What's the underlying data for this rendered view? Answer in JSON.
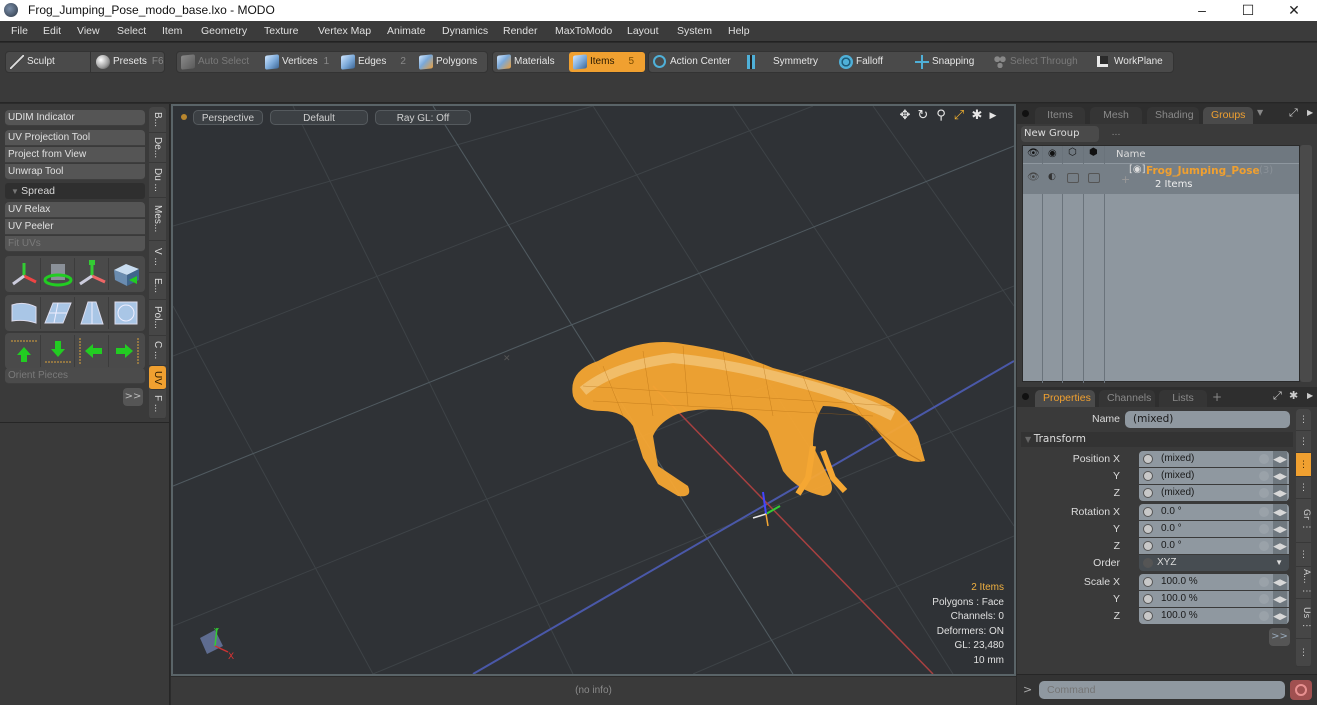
{
  "window": {
    "title": "Frog_Jumping_Pose_modo_base.lxo - MODO",
    "minimize": "–",
    "maximize": "☐",
    "close": "✕"
  },
  "menu": [
    "File",
    "Edit",
    "View",
    "Select",
    "Item",
    "Geometry",
    "Texture",
    "Vertex Map",
    "Animate",
    "Dynamics",
    "Render",
    "MaxToModo",
    "Layout",
    "System",
    "Help"
  ],
  "toolbar": {
    "sculpt": "Sculpt",
    "presets": "Presets",
    "presets_key": "F6",
    "auto_select": "Auto Select",
    "vertices": "Vertices",
    "vertices_key": "1",
    "edges": "Edges",
    "edges_key": "2",
    "polygons": "Polygons",
    "materials": "Materials",
    "items": "Items",
    "items_key": "5",
    "action_center": "Action Center",
    "symmetry": "Symmetry",
    "falloff": "Falloff",
    "snapping": "Snapping",
    "select_through": "Select Through",
    "workplane": "WorkPlane"
  },
  "left_panel": {
    "udim": "UDIM Indicator",
    "uv_projection": "UV Projection Tool",
    "project_from_view": "Project from View",
    "unwrap": "Unwrap Tool",
    "spread": "Spread",
    "uv_relax": "UV Relax",
    "uv_peeler": "UV Peeler",
    "fit_uvs": "Fit UVs",
    "orient_pieces": "Orient Pieces",
    "more": ">>",
    "vtabs": [
      "B...",
      "De...",
      "Du ...",
      "Mes...",
      "V ...",
      "E...",
      "Pol...",
      "C ...",
      "UV",
      "F ..."
    ],
    "active_vtab": "UV"
  },
  "viewport": {
    "view": "Perspective",
    "shading": "Default",
    "raygl": "Ray GL: Off",
    "info": {
      "items": "2 Items",
      "polygons": "Polygons : Face",
      "channels": "Channels: 0",
      "deformers": "Deformers: ON",
      "gl": "GL: 23,480",
      "grid": "10 mm"
    },
    "status": "(no info)",
    "axis_x": "X",
    "axis_y": "Y"
  },
  "groups_panel": {
    "tabs": [
      "Items",
      "Mesh ...",
      "Shading",
      "Groups"
    ],
    "active_tab": "Groups",
    "new_group": "New Group",
    "column_name": "Name",
    "group_name": "Frog_Jumping_Pose",
    "group_count": "(3)",
    "group_sub": "2 Items"
  },
  "properties_panel": {
    "tabs": [
      "Properties",
      "Channels",
      "Lists",
      "+"
    ],
    "active_tab": "Properties",
    "name_label": "Name",
    "name_value": "(mixed)",
    "transform_section": "Transform",
    "position": [
      {
        "label": "Position X",
        "value": "(mixed)"
      },
      {
        "label": "Y",
        "value": "(mixed)"
      },
      {
        "label": "Z",
        "value": "(mixed)"
      }
    ],
    "rotation": [
      {
        "label": "Rotation X",
        "value": "0.0 °"
      },
      {
        "label": "Y",
        "value": "0.0 °"
      },
      {
        "label": "Z",
        "value": "0.0 °"
      }
    ],
    "order_label": "Order",
    "order_value": "XYZ",
    "scale": [
      {
        "label": "Scale X",
        "value": "100.0 %"
      },
      {
        "label": "Y",
        "value": "100.0 %"
      },
      {
        "label": "Z",
        "value": "100.0 %"
      }
    ],
    "more": ">>",
    "side_tabs": [
      "⋮",
      "⋮",
      "⋮",
      "⋮",
      "Gr ⋮",
      "⋮",
      "A... ⋮",
      "Us ⋮",
      "⋮"
    ]
  },
  "command": {
    "prompt": ">",
    "placeholder": "Command"
  },
  "colors": {
    "accent": "#f0a030",
    "selection_mesh": "#f5a733",
    "viewport_bg": "#2f3236"
  }
}
